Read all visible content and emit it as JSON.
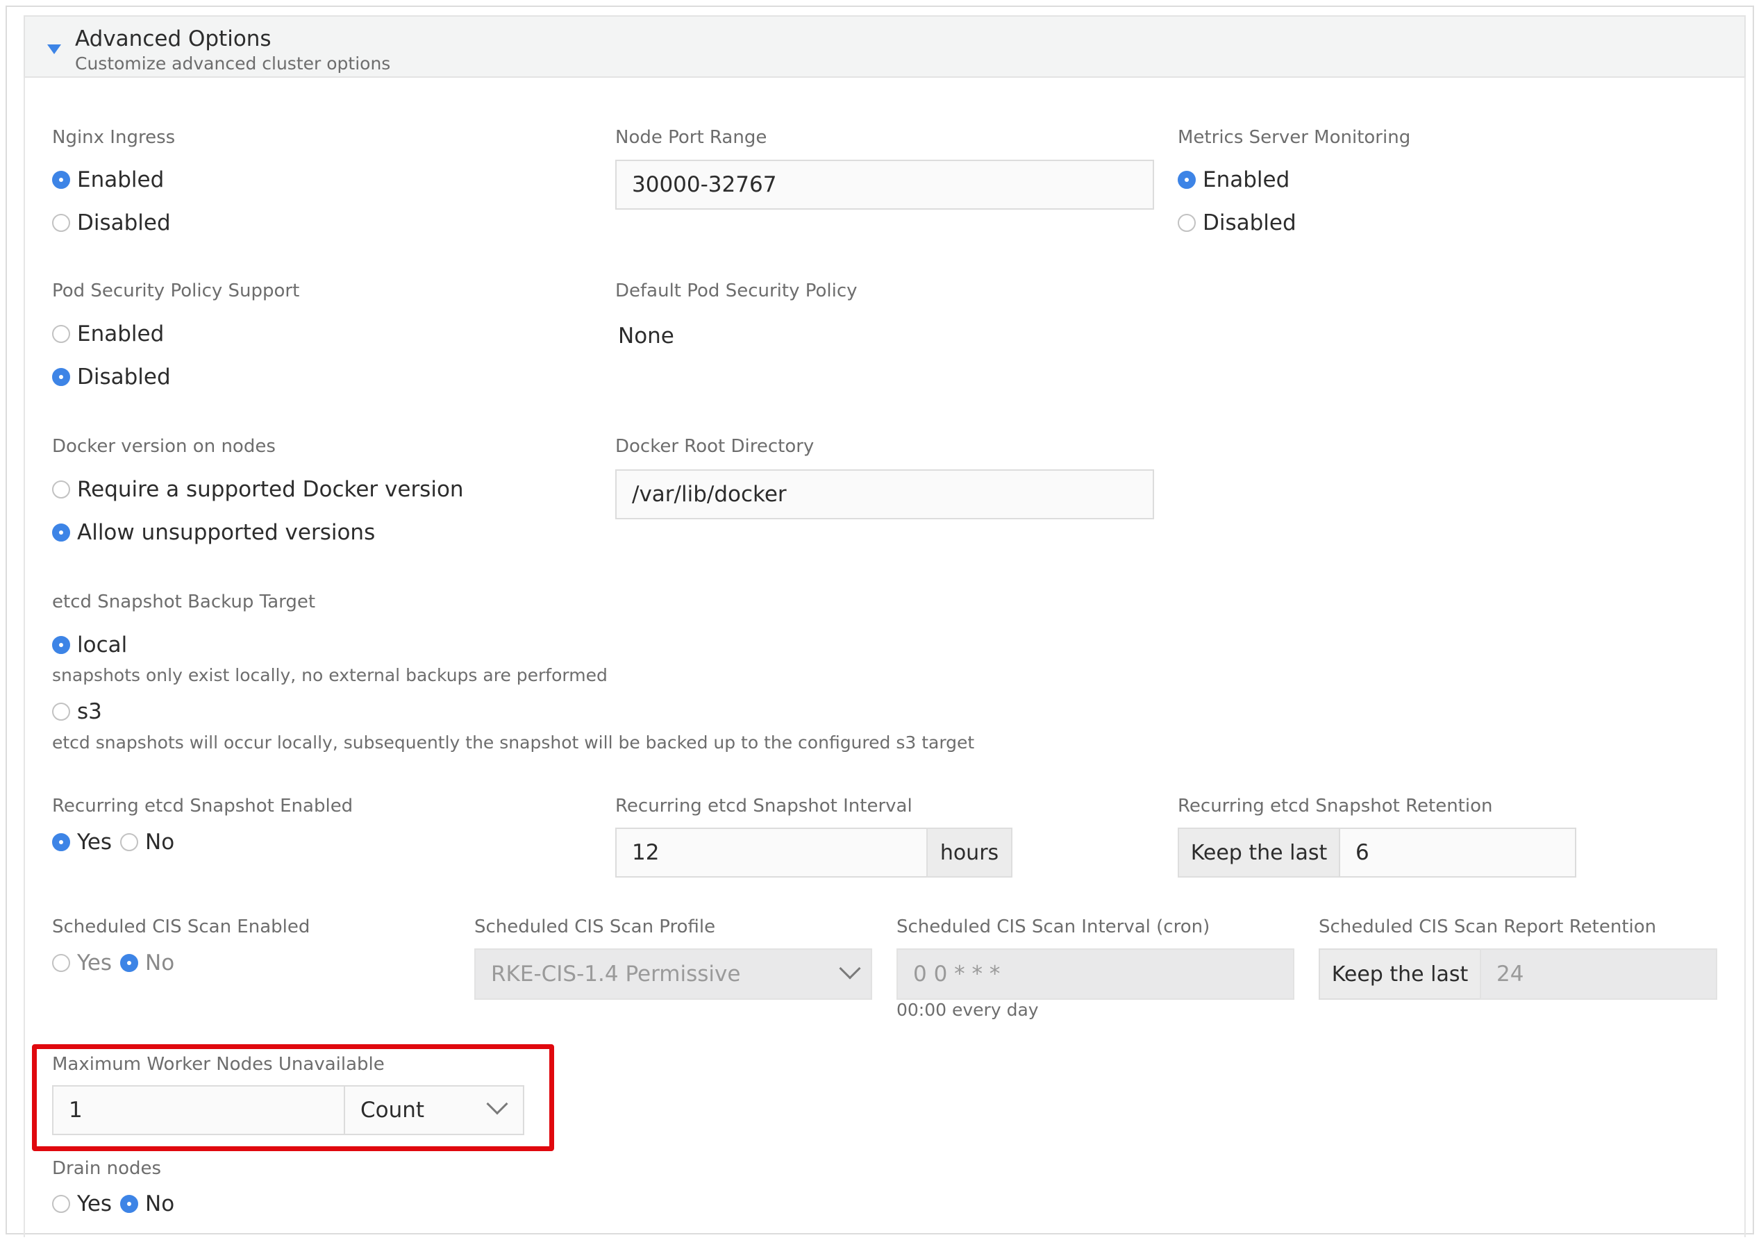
{
  "header": {
    "title": "Advanced Options",
    "subtitle": "Customize advanced cluster options"
  },
  "nginx_ingress": {
    "label": "Nginx Ingress",
    "options": [
      "Enabled",
      "Disabled"
    ],
    "selected": "Enabled"
  },
  "node_port_range": {
    "label": "Node Port Range",
    "value": "30000-32767"
  },
  "metrics_server": {
    "label": "Metrics Server Monitoring",
    "options": [
      "Enabled",
      "Disabled"
    ],
    "selected": "Enabled"
  },
  "pod_security": {
    "label": "Pod Security Policy Support",
    "options": [
      "Enabled",
      "Disabled"
    ],
    "selected": "Disabled"
  },
  "default_psp": {
    "label": "Default Pod Security Policy",
    "value": "None"
  },
  "docker_version": {
    "label": "Docker version on nodes",
    "options": [
      "Require a supported Docker version",
      "Allow unsupported versions"
    ],
    "selected": "Allow unsupported versions"
  },
  "docker_root": {
    "label": "Docker Root Directory",
    "value": "/var/lib/docker"
  },
  "etcd_backup": {
    "label": "etcd Snapshot Backup Target",
    "options": [
      "local",
      "s3"
    ],
    "selected": "local",
    "local_help": "snapshots only exist locally, no external backups are performed",
    "s3_help": "etcd snapshots will occur locally, subsequently the snapshot will be backed up to the configured s3 target"
  },
  "recurring_snapshot": {
    "label": "Recurring etcd Snapshot Enabled",
    "options": [
      "Yes",
      "No"
    ],
    "selected": "Yes"
  },
  "snapshot_interval": {
    "label": "Recurring etcd Snapshot Interval",
    "value": "12",
    "unit": "hours"
  },
  "snapshot_retention": {
    "label": "Recurring etcd Snapshot Retention",
    "prefix": "Keep the last",
    "value": "6"
  },
  "cis_scan": {
    "label": "Scheduled CIS Scan Enabled",
    "options": [
      "Yes",
      "No"
    ],
    "selected": "No"
  },
  "cis_profile": {
    "label": "Scheduled CIS Scan Profile",
    "value": "RKE-CIS-1.4 Permissive"
  },
  "cis_interval": {
    "label": "Scheduled CIS Scan Interval (cron)",
    "value": "0 0 * * *",
    "help": "00:00 every day"
  },
  "cis_retention": {
    "label": "Scheduled CIS Scan Report Retention",
    "prefix": "Keep the last",
    "value": "24"
  },
  "max_unavailable": {
    "label": "Maximum Worker Nodes Unavailable",
    "value": "1",
    "unit": "Count"
  },
  "drain_nodes": {
    "label": "Drain nodes",
    "options": [
      "Yes",
      "No"
    ],
    "selected": "No"
  },
  "colors": {
    "accent": "#3d84e6",
    "highlight": "#e0080e"
  }
}
